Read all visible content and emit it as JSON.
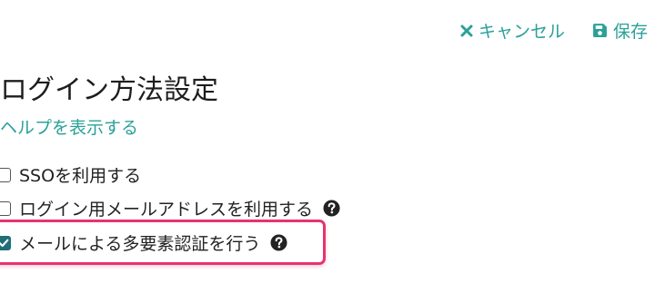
{
  "header": {
    "cancel_label": "キャンセル",
    "save_label": "保存",
    "cancel_icon": "close-icon",
    "save_icon": "floppy-disk-icon"
  },
  "title": "ログイン方法設定",
  "help_link": "ヘルプを表示する",
  "options": [
    {
      "label": "SSOを利用する",
      "checked": false,
      "has_help_icon": false
    },
    {
      "label": "ログイン用メールアドレスを利用する",
      "checked": false,
      "has_help_icon": true
    },
    {
      "label": "メールによる多要素認証を行う",
      "checked": true,
      "has_help_icon": true
    }
  ],
  "colors": {
    "accent": "#2aa198",
    "checkbox_checked": "#1f6e78",
    "highlight_border": "#e8336d"
  }
}
